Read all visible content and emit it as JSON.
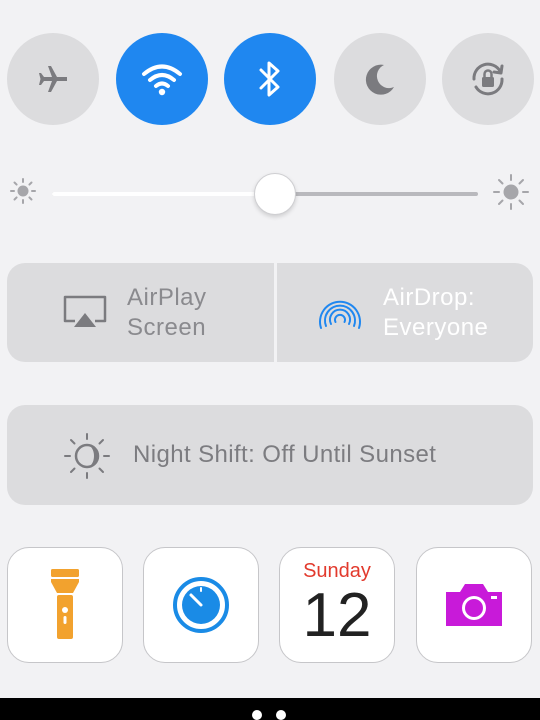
{
  "toggles": [
    {
      "icon": "airplane-icon",
      "state": "off"
    },
    {
      "icon": "wifi-icon",
      "state": "on"
    },
    {
      "icon": "bluetooth-icon",
      "state": "on"
    },
    {
      "icon": "moon-icon",
      "state": "off"
    },
    {
      "icon": "rotation-lock-icon",
      "state": "off"
    }
  ],
  "brightness": {
    "level": 0.52
  },
  "airplay": {
    "line1": "AirPlay",
    "line2": "Screen"
  },
  "airdrop": {
    "line1": "AirDrop:",
    "line2": "Everyone"
  },
  "night_shift": {
    "label": "Night Shift: Off Until Sunset"
  },
  "shortcuts": [
    {
      "icon": "flashlight-icon"
    },
    {
      "icon": "timer-icon"
    },
    {
      "icon": "calendar-icon",
      "day": "Sunday",
      "date": "12"
    },
    {
      "icon": "camera-icon"
    }
  ],
  "colors": {
    "accent": "#1f87f0",
    "toggle_off": "#dcdcde",
    "flashlight": "#f2a22e",
    "timer": "#1a8be6",
    "camera": "#c81ad9",
    "calendar_day": "#e23a2d"
  }
}
